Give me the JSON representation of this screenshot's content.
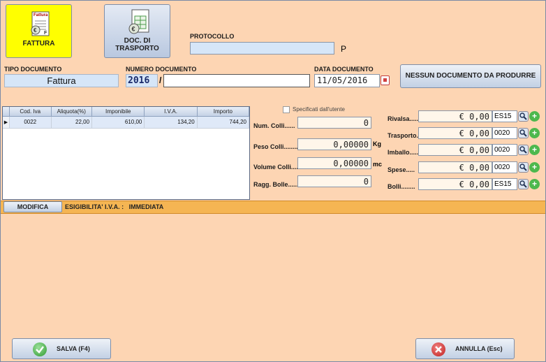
{
  "toolbar": {
    "fattura_label": "FATTURA",
    "ddt_label_1": "DOC. DI",
    "ddt_label_2": "TRASPORTO",
    "fattura_icon_text": "Fattura"
  },
  "header": {
    "protocollo_label": "PROTOCOLLO",
    "protocollo_value": "",
    "protocollo_suffix": "P",
    "tipo_label": "TIPO DOCUMENTO",
    "tipo_value": "Fattura",
    "numero_label": "NUMERO DOCUMENTO",
    "numero_year": "2016",
    "numero_sep": "/",
    "numero_value": "",
    "data_label": "DATA DOCUMENTO",
    "data_value": "11/05/2016",
    "nessun_button": "NESSUN DOCUMENTO DA PRODURRE"
  },
  "iva_table": {
    "columns": [
      "Cod. Iva",
      "Aliquota(%)",
      "Imponibile",
      "I.V.A.",
      "Importo"
    ],
    "rows": [
      [
        "0022",
        "22,00",
        "610,00",
        "134,20",
        "744,20"
      ]
    ]
  },
  "fields": {
    "specificati_label": "Specificati dall'utente",
    "num_colli_label": "Num. Colli......",
    "num_colli_value": "0",
    "peso_label": "Peso Colli.........",
    "peso_value": "0,00000",
    "peso_unit": "Kg",
    "volume_label": "Volume Colli......",
    "volume_value": "0,00000",
    "volume_unit": "mc",
    "ragg_label": "Ragg. Bolle.......",
    "ragg_value": "0"
  },
  "costs": [
    {
      "label": "Rivalsa.....",
      "value": "€ 0,00",
      "code": "ES15"
    },
    {
      "label": "Trasporto.",
      "value": "€ 0,00",
      "code": "0020"
    },
    {
      "label": "Imballo.....",
      "value": "€ 0,00",
      "code": "0020"
    },
    {
      "label": "Spese.....",
      "value": "€ 0,00",
      "code": "0020"
    },
    {
      "label": "Bolli........",
      "value": "€ 0,00",
      "code": "ES15"
    }
  ],
  "status": {
    "modifica_label": "MODIFICA",
    "esigibilita_text": "ESIGIBILITA' I.V.A. :   IMMEDIATA"
  },
  "footer": {
    "salva_label": "SALVA (F4)",
    "annulla_label": "ANNULLA (Esc)"
  },
  "colors": {
    "background": "#fdd5b3",
    "fattura_yellow": "#ffff00",
    "status_bar": "#f5b553"
  }
}
